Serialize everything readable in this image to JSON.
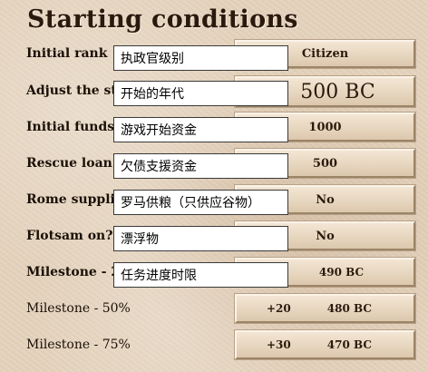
{
  "title": "Starting conditions",
  "rows": [
    {
      "label": "Initial rank",
      "value": "Citizen",
      "overlay": "执政官级别"
    },
    {
      "label": "Adjust the st",
      "value": "500 BC",
      "overlay": "开始的年代"
    },
    {
      "label": "Initial funds",
      "value": "1000",
      "overlay": "游戏开始资金"
    },
    {
      "label": "Rescue loan",
      "value": "500",
      "overlay": "欠债支援资金"
    },
    {
      "label": "Rome suppli",
      "value": "No",
      "overlay": "罗马供粮（只供应谷物）"
    },
    {
      "label": "Flotsam on?",
      "value": "No",
      "overlay": "漂浮物"
    },
    {
      "label": "Milestone - 2",
      "value": "490 BC",
      "overlay": "任务进度时限"
    },
    {
      "label": "Milestone - 50%",
      "offset": "+20",
      "value": "480 BC"
    },
    {
      "label": "Milestone - 75%",
      "offset": "+30",
      "value": "470 BC"
    }
  ]
}
